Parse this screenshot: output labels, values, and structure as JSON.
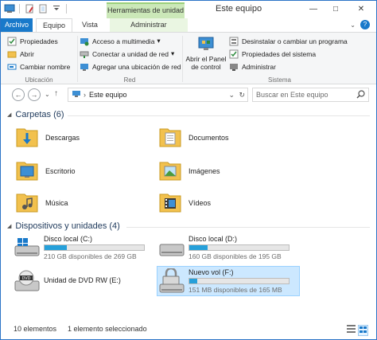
{
  "titlebar": {
    "context_tab": "Herramientas de unidad",
    "title": "Este equipo",
    "minimize": "—",
    "maximize": "□",
    "close": "✕"
  },
  "tabs": {
    "file": "Archivo",
    "equipo": "Equipo",
    "vista": "Vista",
    "administrar": "Administrar"
  },
  "ribbon": {
    "ubicacion": {
      "label": "Ubicación",
      "propiedades": "Propiedades",
      "abrir": "Abrir",
      "cambiar_nombre": "Cambiar nombre"
    },
    "red": {
      "label": "Red",
      "acceso_multimedia": "Acceso a multimedia",
      "conectar_unidad": "Conectar a unidad de red",
      "agregar_ubicacion": "Agregar una ubicación de red"
    },
    "sistema": {
      "label": "Sistema",
      "abrir_panel_line1": "Abrir el Panel",
      "abrir_panel_line2": "de control",
      "desinstalar": "Desinstalar o cambiar un programa",
      "propiedades_sistema": "Propiedades del sistema",
      "administrar": "Administrar"
    }
  },
  "navbar": {
    "address": "Este equipo",
    "search_placeholder": "Buscar en Este equipo"
  },
  "folders": {
    "header": "Carpetas (6)",
    "items": [
      "Descargas",
      "Documentos",
      "Escritorio",
      "Imágenes",
      "Música",
      "Vídeos"
    ]
  },
  "drives": {
    "header": "Dispositivos y unidades (4)",
    "items": [
      {
        "name": "Disco local (C:)",
        "free": "210 GB disponibles de 269 GB",
        "used_fraction": 0.22
      },
      {
        "name": "Disco local (D:)",
        "free": "160 GB disponibles de 195 GB",
        "used_fraction": 0.18
      },
      {
        "name": "Unidad de DVD RW (E:)"
      },
      {
        "name": "Nuevo vol (F:)",
        "free": "151 MB disponibles de 165 MB",
        "used_fraction": 0.08
      }
    ]
  },
  "statusbar": {
    "count": "10 elementos",
    "selected": "1 elemento seleccionado"
  },
  "colors": {
    "accent": "#1979ca",
    "context_green": "#cbe8b8",
    "bar_fill": "#26a0da",
    "selection": "#cce8ff"
  }
}
